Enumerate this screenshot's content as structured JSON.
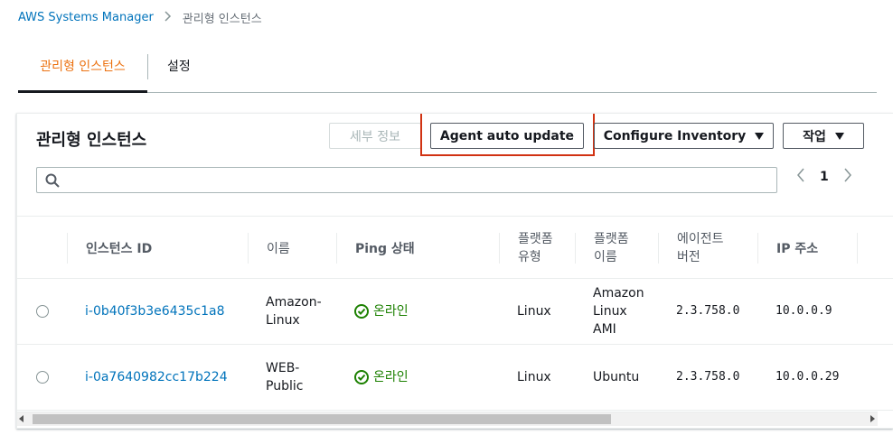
{
  "breadcrumb": {
    "root": "AWS Systems Manager",
    "current": "관리형 인스턴스"
  },
  "tabs": [
    {
      "label": "관리형 인스턴스",
      "active": true
    },
    {
      "label": "설정",
      "active": false
    }
  ],
  "panel": {
    "title": "관리형 인스턴스",
    "buttons": {
      "details": "세부 정보",
      "agent_auto_update": "Agent auto update",
      "configure_inventory": "Configure Inventory",
      "actions": "작업"
    },
    "search": {
      "value": "",
      "placeholder": ""
    },
    "pagination": {
      "page": "1"
    }
  },
  "table": {
    "columns": {
      "instance_id": "인스턴스 ID",
      "name": "이름",
      "ping": "Ping 상태",
      "platform_type": [
        "플랫폼",
        "유형"
      ],
      "platform_name": [
        "플랫폼",
        "이름"
      ],
      "agent_version": [
        "에이전트",
        "버전"
      ],
      "ip": "IP 주소"
    },
    "rows": [
      {
        "instance_id": "i-0b40f3b3e6435c1a8",
        "name": [
          "Amazon-",
          "Linux"
        ],
        "ping": "온라인",
        "platform_type": "Linux",
        "platform_name": [
          "Amazon",
          "Linux",
          "AMI"
        ],
        "agent_version": "2.3.758.0",
        "ip": "10.0.0.9"
      },
      {
        "instance_id": "i-0a7640982cc17b224",
        "name": [
          "WEB-",
          "Public"
        ],
        "ping": "온라인",
        "platform_type": "Linux",
        "platform_name": [
          "Ubuntu"
        ],
        "agent_version": "2.3.758.0",
        "ip": "10.0.0.29"
      }
    ]
  },
  "colors": {
    "link": "#0073bb",
    "active_tab": "#ec7211",
    "online": "#1d8102",
    "highlight": "#d13212"
  },
  "icons": {
    "breadcrumb_separator": "chevron-right-icon",
    "search": "search-icon",
    "pager_prev": "chevron-left-icon",
    "pager_next": "chevron-right-icon",
    "online": "check-circle-icon",
    "dropdown": "caret-down-icon"
  }
}
